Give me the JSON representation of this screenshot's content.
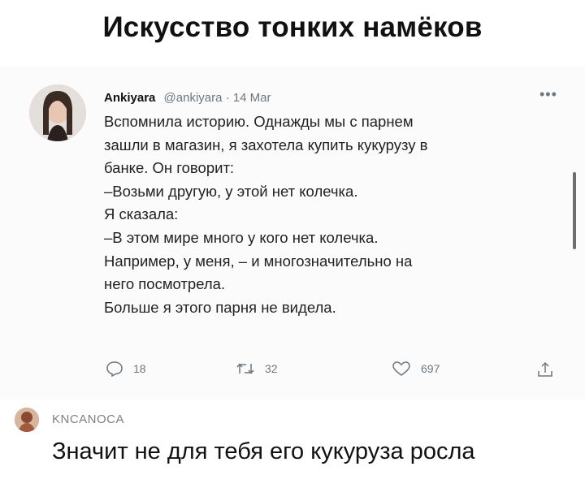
{
  "page": {
    "title": "Искусство тонких намёков"
  },
  "tweet": {
    "author_name": "Ankiyara",
    "handle": "@ankiyara",
    "separator": "·",
    "date": "14 Mar",
    "more_icon": "more-horizontal-icon",
    "lines": [
      "Вспомнила историю. Однажды мы с парнем",
      "зашли в магазин, я захотела купить кукурузу в",
      "банке. Он говорит:",
      "–Возьми другую, у этой нет колечка.",
      "Я сказала:",
      "–В этом мире много у кого нет колечка.",
      "Например, у меня, – и многозначительно на",
      "него посмотрела.",
      "Больше я этого парня не видела."
    ],
    "actions": {
      "replies": "18",
      "retweets": "32",
      "likes": "697"
    },
    "icons": [
      "reply-icon",
      "retweet-icon",
      "heart-icon",
      "share-icon"
    ],
    "icon_color": "#6d7780"
  },
  "comment": {
    "author": "KNCANOCA",
    "text": "Значит не для тебя его кукуруза росла"
  }
}
